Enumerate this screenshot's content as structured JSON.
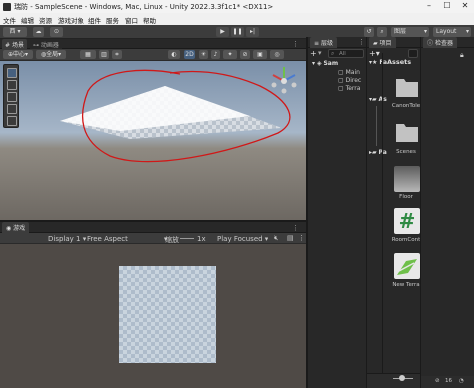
{
  "titlebar": {
    "title": "瑞防 - SampleScene - Windows, Mac, Linux - Unity 2022.3.3f1c1* <DX11>"
  },
  "menu": [
    "文件",
    "编辑",
    "资源",
    "游戏对象",
    "组件",
    "服务",
    "窗口",
    "帮助"
  ],
  "toolbar": {
    "account": "西",
    "layers": "图层",
    "layout": "Layout"
  },
  "scene": {
    "tabs": [
      "场景",
      "动画器"
    ],
    "pivot": "中心",
    "space": "全局",
    "mode2d": "2D"
  },
  "game": {
    "tab": "游戏",
    "display": "Display 1",
    "aspect": "Free Aspect",
    "scale_label": "缩放",
    "scale_value": "1x",
    "play_mode": "Play Focused"
  },
  "hierarchy": {
    "tab": "层级",
    "search_placeholder": "All",
    "items": [
      {
        "label": "Sam",
        "level": 0
      },
      {
        "label": "Main",
        "level": 1
      },
      {
        "label": "Direc",
        "level": 1
      },
      {
        "label": "Terra",
        "level": 1
      }
    ]
  },
  "project": {
    "tab": "项目",
    "tree": [
      "Fa",
      "As",
      "Pa"
    ],
    "breadcrumb": "Assets",
    "assets": [
      {
        "label": "CanonTole",
        "kind": "folder"
      },
      {
        "label": "Scenes",
        "kind": "folder"
      },
      {
        "label": "Floor",
        "kind": "material"
      },
      {
        "label": "RoomCont",
        "kind": "script"
      },
      {
        "label": "New Terra",
        "kind": "terrain"
      }
    ],
    "count": "16"
  },
  "inspector": {
    "tab": "检查器"
  },
  "colors": {
    "annotation_red": "#d01818",
    "accent_green": "#2f8a43",
    "terrain_green": "#6fc04a"
  }
}
